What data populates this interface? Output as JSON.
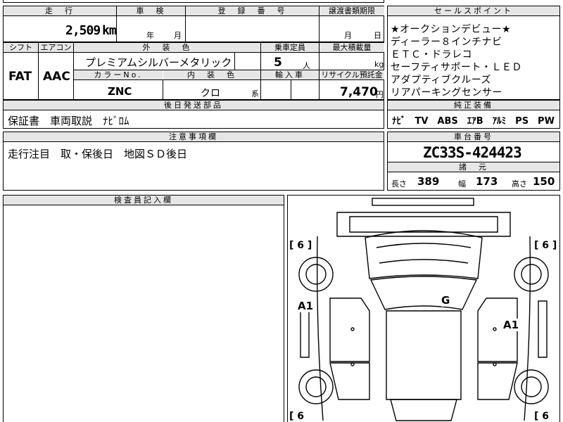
{
  "mileage": {
    "header": "走　行",
    "value": "2,509",
    "unit": "km"
  },
  "inspection": {
    "header": "車　検",
    "year_unit": "年",
    "month_unit": "月"
  },
  "registration": {
    "header": "登　録　番　号"
  },
  "transfer": {
    "header": "譲渡書類期限",
    "month_unit": "月",
    "day_unit": "日"
  },
  "sales_points": {
    "header": "セールスポイント",
    "lines": [
      "★オークションデビュー★",
      "ディーラー８インチナビ",
      "ＥＴＣ・ドラレコ",
      "セーフティサポート・ＬＥＤ",
      "アダプティブクルーズ",
      "リアパーキングセンサー"
    ]
  },
  "shift": {
    "header": "シフト",
    "value": "FAT"
  },
  "aircon": {
    "header": "エアコン",
    "value": "AAC"
  },
  "exterior_color": {
    "header": "外　装　色",
    "value": "プレミアムシルバーメタリック"
  },
  "capacity": {
    "header": "乗車定員",
    "value": "5",
    "unit": "人"
  },
  "max_load": {
    "header": "最大積載量",
    "unit": "kg"
  },
  "color_no": {
    "header": "カラーNo.",
    "value": "ZNC"
  },
  "interior_color": {
    "header": "内　装　色",
    "value": "クロ",
    "suffix": "系"
  },
  "import": {
    "header": "輸入車"
  },
  "recycle": {
    "header": "リサイクル預託金",
    "value": "7,470",
    "unit": "円"
  },
  "later_parts": {
    "header": "後日発送部品",
    "value": "保証書　車両取説　ﾅﾋﾞﾛﾑ"
  },
  "genuine_equipment": {
    "header": "純正装備",
    "value": "ﾅﾋﾞ　TV　ABS　ｴｱB　ｱﾙﾐ　PS　PW"
  },
  "notes": {
    "header": "注意事項欄",
    "value": "走行注目　取・保後日　地図ＳＤ後日"
  },
  "chassis": {
    "header": "車台番号",
    "value": "ZC33S-424423"
  },
  "specs": {
    "header": "諸　元",
    "length_label": "長さ",
    "length": "389",
    "width_label": "幅",
    "width": "173",
    "height_label": "高さ",
    "height": "150"
  },
  "inspector": {
    "header": "検査員記入欄"
  },
  "diagram": {
    "marks": [
      {
        "label": "[ 6 ]",
        "pos": "front-left"
      },
      {
        "label": "[ 6 ]",
        "pos": "front-right"
      },
      {
        "label": "A1",
        "pos": "left-door"
      },
      {
        "label": "G",
        "pos": "windshield"
      },
      {
        "label": "A1",
        "pos": "right-door"
      },
      {
        "label": "[ 6",
        "pos": "rear-left"
      },
      {
        "label": "[ 6",
        "pos": "rear-right"
      }
    ]
  }
}
